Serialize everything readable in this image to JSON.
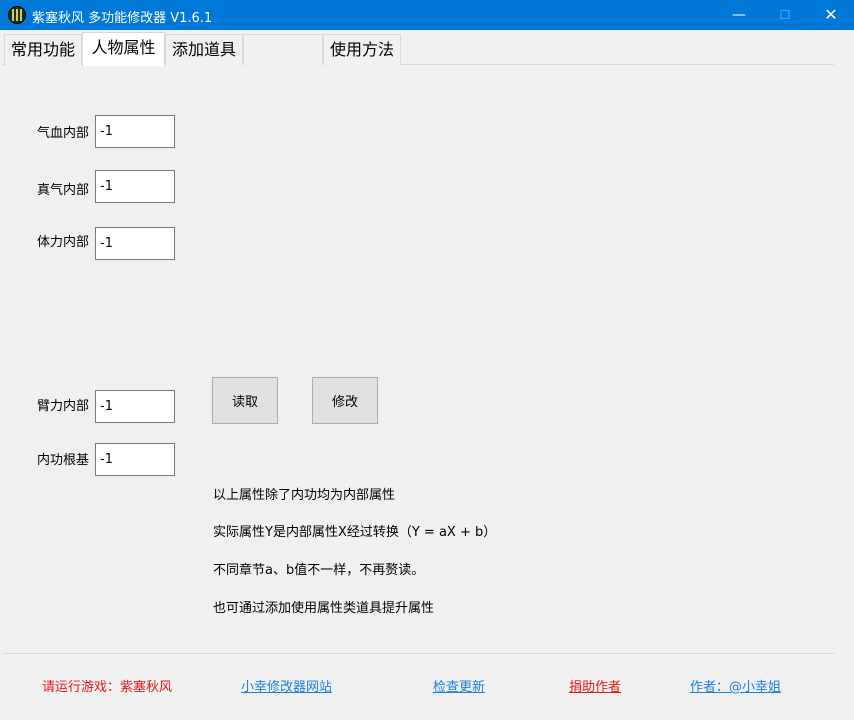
{
  "window": {
    "title": "紫塞秋风 多功能修改器  V1.6.1",
    "min_glyph": "—",
    "max_glyph": "☐",
    "close_glyph": "✕"
  },
  "tabs": [
    {
      "label": "常用功能"
    },
    {
      "label": "人物属性",
      "active": true
    },
    {
      "label": "添加道具"
    },
    {
      "label": ""
    },
    {
      "label": "使用方法"
    }
  ],
  "fields": [
    {
      "label": "气血内部",
      "value": "-1"
    },
    {
      "label": "真气内部",
      "value": "-1"
    },
    {
      "label": "体力内部",
      "value": "-1"
    },
    {
      "label": "臂力内部",
      "value": "-1"
    },
    {
      "label": "内功根基",
      "value": "-1"
    }
  ],
  "buttons": {
    "read": "读取",
    "modify": "修改"
  },
  "notes": [
    "以上属性除了内功均为内部属性",
    "实际属性Y是内部属性X经过转换（Y = aX + b）",
    "不同章节a、b值不一样，不再赘读。",
    "也可通过添加使用属性类道具提升属性"
  ],
  "footer": {
    "run_game": "请运行游戏：紫塞秋风",
    "site_link": "小幸修改器网站",
    "update_link": "检查更新",
    "donate_link": "捐助作者",
    "author_link": "作者：@小幸姐"
  },
  "colors": {
    "titlebar": "#0078d7",
    "accent_red": "#e41a1a",
    "link_blue": "#1e7fd9"
  }
}
